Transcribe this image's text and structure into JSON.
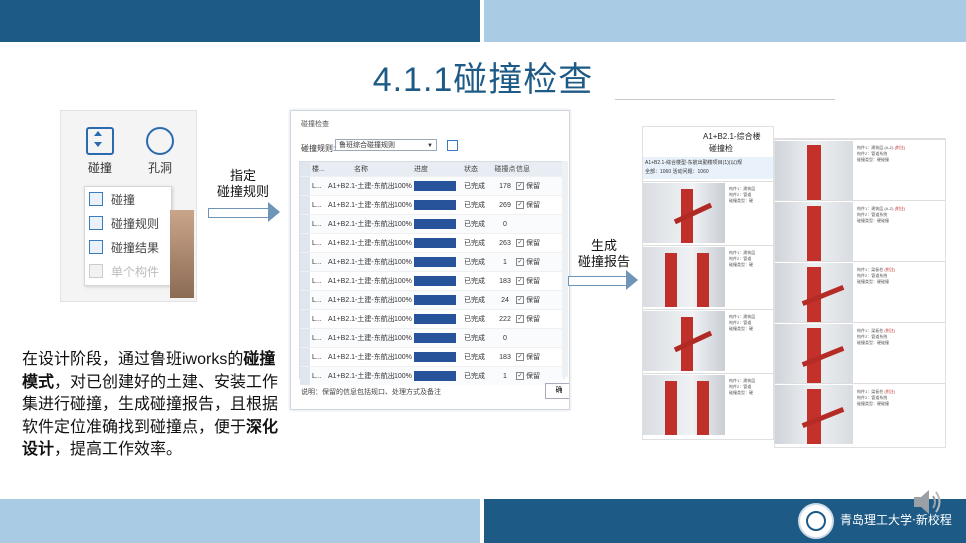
{
  "slide": {
    "title": "4.1.1碰撞检查"
  },
  "ribbon": {
    "collision_button": "碰撞",
    "hole_button": "孔洞",
    "menu_items": [
      "碰撞",
      "碰撞规则",
      "碰撞结果",
      "单个构件"
    ]
  },
  "arrows": {
    "specify_rules": [
      "指定",
      "碰撞规则"
    ],
    "generate_report": [
      "生成",
      "碰撞报告"
    ]
  },
  "dialog": {
    "title": "碰撞检查",
    "rule_label": "碰撞规则:",
    "rule_value": "鲁班综合碰撞规则",
    "columns": [
      "楼...",
      "名称",
      "进度",
      "状态",
      "碰撞点",
      "信息"
    ],
    "rows": [
      {
        "idx": "L...",
        "name": "A1+B2.1-土建-东航出...",
        "pct": "100%",
        "status": "已完成",
        "count": "178",
        "info": "保留"
      },
      {
        "idx": "L...",
        "name": "A1+B2.1-土建-东航出...",
        "pct": "100%",
        "status": "已完成",
        "count": "269",
        "info": "保留"
      },
      {
        "idx": "L...",
        "name": "A1+B2.1-土建-东航出...",
        "pct": "100%",
        "status": "已完成",
        "count": "0",
        "info": ""
      },
      {
        "idx": "L...",
        "name": "A1+B2.1-土建-东航出...",
        "pct": "100%",
        "status": "已完成",
        "count": "263",
        "info": "保留"
      },
      {
        "idx": "L...",
        "name": "A1+B2.1-土建-东航出...",
        "pct": "100%",
        "status": "已完成",
        "count": "1",
        "info": "保留"
      },
      {
        "idx": "L...",
        "name": "A1+B2.1-土建-东航出...",
        "pct": "100%",
        "status": "已完成",
        "count": "183",
        "info": "保留"
      },
      {
        "idx": "L...",
        "name": "A1+B2.1-土建-东航出...",
        "pct": "100%",
        "status": "已完成",
        "count": "24",
        "info": "保留"
      },
      {
        "idx": "L...",
        "name": "A1+B2.1-土建-东航出...",
        "pct": "100%",
        "status": "已完成",
        "count": "222",
        "info": "保留"
      },
      {
        "idx": "L...",
        "name": "A1+B2.1-土建-东航出...",
        "pct": "100%",
        "status": "已完成",
        "count": "0",
        "info": ""
      },
      {
        "idx": "L...",
        "name": "A1+B2.1-土建-东航出...",
        "pct": "100%",
        "status": "已完成",
        "count": "183",
        "info": "保留"
      },
      {
        "idx": "L...",
        "name": "A1+B2.1-土建-东航出...",
        "pct": "100%",
        "status": "已完成",
        "count": "1",
        "info": "保留"
      }
    ],
    "note": "说明：保留的信息包括规口、处理方式及备注",
    "ok_button": "确"
  },
  "body": {
    "t1": "在设计阶段，通过鲁班iworks的",
    "t2_bold": "碰撞模式",
    "t3": "，对已创建好的土建、安装工作集进行碰撞，生成碰撞报告，且根据软件定位准确找到碰撞点，便于",
    "t4_bold": "深化设计",
    "t5": "，提高工作效率。"
  },
  "report1": {
    "title": "A1+B2.1-综合楼",
    "subtitle": "碰撞检",
    "header_line1": "A1+B2.1-综合楼型-东航出勤楼项目(1)(以)规",
    "header_line2": "全部：1060  活动问题：1060",
    "entries": [
      {
        "l1": "构件1：建筑层",
        "l2": "构件2：管道",
        "l3": "碰撞类型：硬"
      },
      {
        "l1": "构件1：建筑层",
        "l2": "构件2：管道",
        "l3": "碰撞类型：硬"
      },
      {
        "l1": "构件1：建筑层",
        "l2": "构件2：管道",
        "l3": "碰撞类型：硬"
      },
      {
        "l1": "构件1：建筑层",
        "l2": "构件2：管道",
        "l3": "碰撞类型：硬"
      }
    ]
  },
  "report2": {
    "entries": [
      {
        "l1": "构件1：建筑层 (A-Z)",
        "l2": "构件2：管道系统",
        "l3": "碰撞类型：硬碰撞",
        "link": "(附注)"
      },
      {
        "l1": "构件1：建筑层 (A-Z)",
        "l2": "构件2：管道系统",
        "l3": "碰撞类型：硬碰撞",
        "link": "(附注)"
      },
      {
        "l1": "构件1：梁板柱",
        "l2": "构件2：管道系统",
        "l3": "碰撞类型：硬碰撞",
        "link": "(附注)"
      },
      {
        "l1": "构件1：梁板柱",
        "l2": "构件2：管道系统",
        "l3": "碰撞类型：硬碰撞",
        "link": "(附注)"
      },
      {
        "l1": "构件1：梁板柱",
        "l2": "构件2：管道系统",
        "l3": "碰撞类型：硬碰撞",
        "link": "(附注)"
      }
    ]
  },
  "footer": {
    "text": "青岛理工大学·新校程"
  },
  "colors": {
    "brand_dark": "#1e5a86",
    "brand_light": "#a9cbe3",
    "progress": "#27539a",
    "column_red": "#c0302a"
  }
}
